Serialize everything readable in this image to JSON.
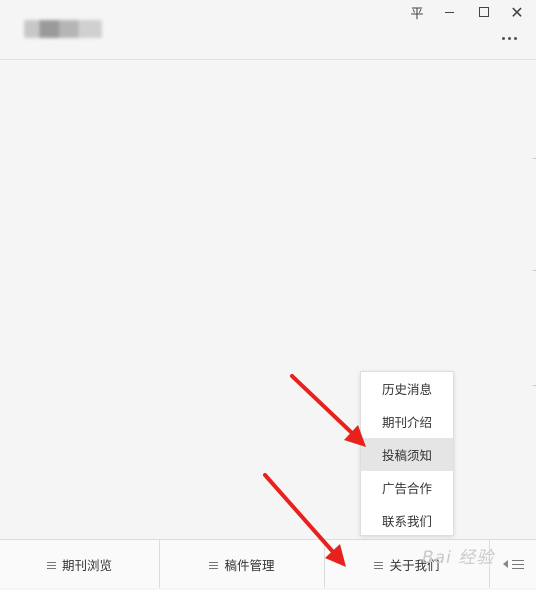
{
  "window": {
    "pin_glyph": "平",
    "close_glyph": "✕"
  },
  "popup_menu": {
    "items": [
      {
        "label": "历史消息",
        "selected": false
      },
      {
        "label": "期刊介绍",
        "selected": false
      },
      {
        "label": "投稿须知",
        "selected": true
      },
      {
        "label": "广告合作",
        "selected": false
      },
      {
        "label": "联系我们",
        "selected": false
      }
    ]
  },
  "tabbar": {
    "tabs": [
      {
        "label": "期刊浏览"
      },
      {
        "label": "稿件管理"
      },
      {
        "label": "关于我们"
      }
    ]
  },
  "watermark": {
    "text": "Bai 经验"
  },
  "colors": {
    "arrow": "#e8211c",
    "background": "#f5f5f5",
    "popup_selected": "#e5e5e5"
  }
}
